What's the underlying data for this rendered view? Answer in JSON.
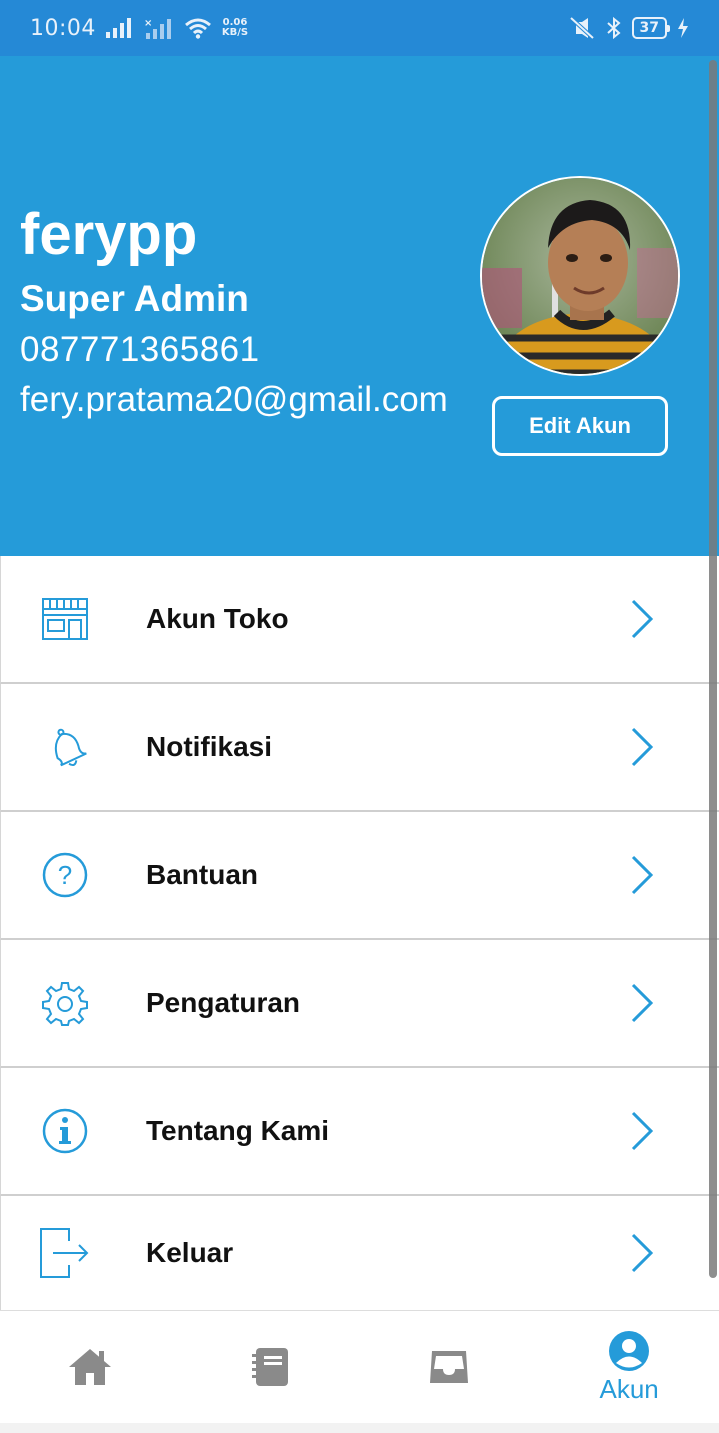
{
  "status_bar": {
    "time": "10:04",
    "net_speed_value": "0.06",
    "net_speed_unit": "KB/S",
    "battery": "37"
  },
  "profile": {
    "name": "ferypp",
    "role": "Super Admin",
    "phone": "087771365861",
    "email": "fery.pratama20@gmail.com",
    "edit_button_label": "Edit Akun"
  },
  "menu": {
    "items": [
      {
        "label": "Akun Toko",
        "icon": "store-icon"
      },
      {
        "label": "Notifikasi",
        "icon": "bell-icon"
      },
      {
        "label": "Bantuan",
        "icon": "help-icon"
      },
      {
        "label": "Pengaturan",
        "icon": "gear-icon"
      },
      {
        "label": "Tentang Kami",
        "icon": "info-icon"
      },
      {
        "label": "Keluar",
        "icon": "logout-icon"
      }
    ]
  },
  "bottom_nav": {
    "items": [
      {
        "icon": "home-icon",
        "label": ""
      },
      {
        "icon": "notebook-icon",
        "label": ""
      },
      {
        "icon": "inbox-icon",
        "label": ""
      },
      {
        "icon": "account-icon",
        "label": "Akun"
      }
    ],
    "active_index": 3
  },
  "colors": {
    "primary": "#259bd9",
    "status_bar": "#2589d6",
    "inactive_icon": "#8a8a8a",
    "menu_icon": "#259bd9"
  }
}
